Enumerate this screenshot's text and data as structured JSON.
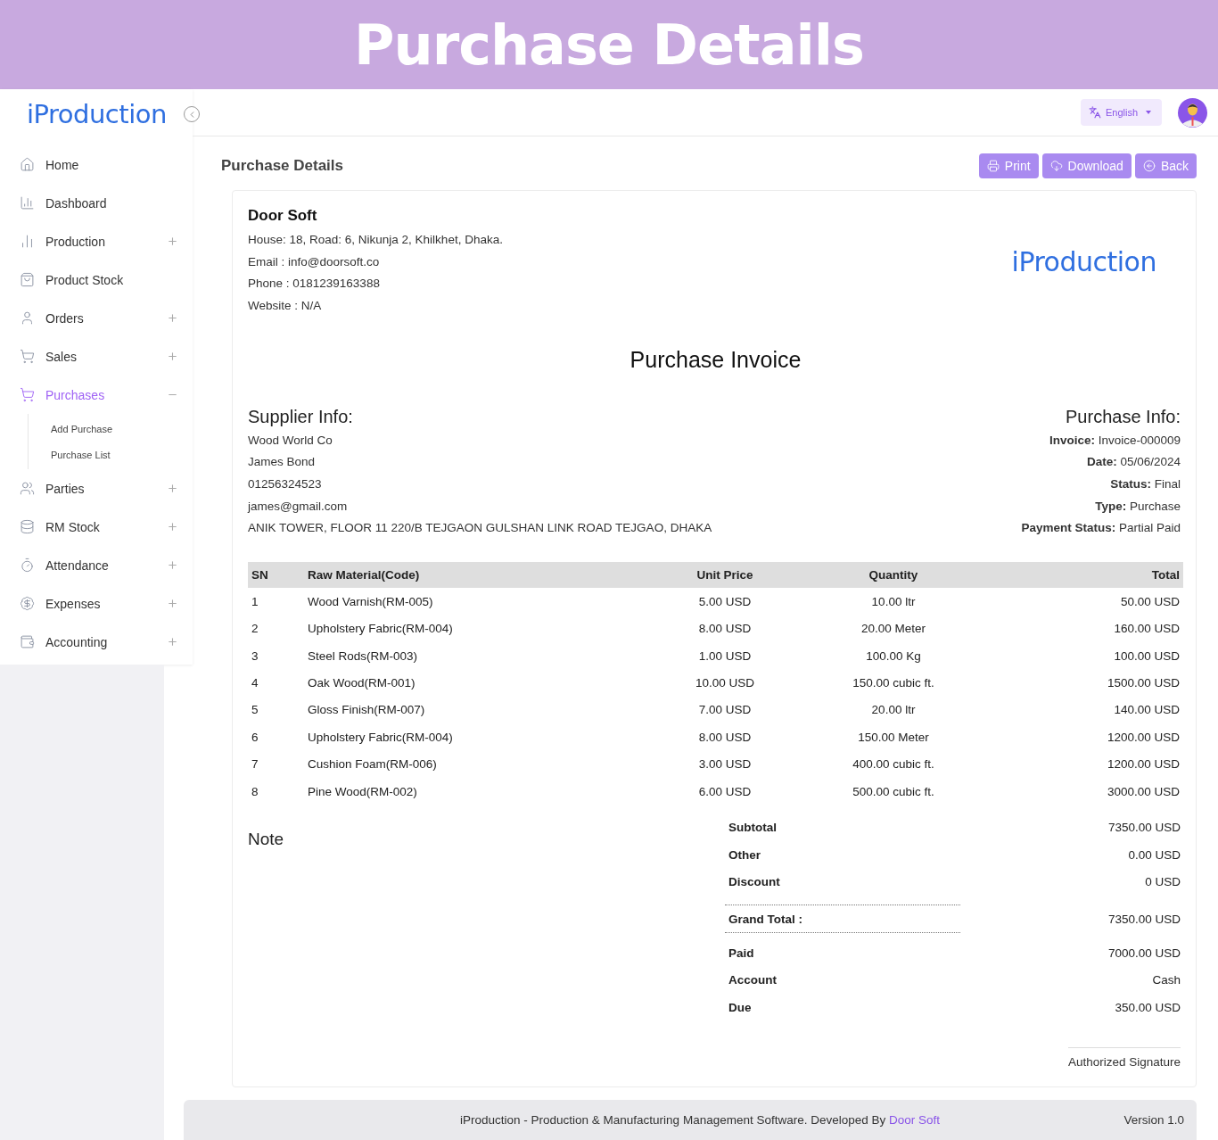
{
  "banner": {
    "title": "Purchase Details"
  },
  "sidebar": {
    "logo": "iProduction",
    "items": [
      {
        "label": "Home",
        "selected": false
      },
      {
        "label": "Dashboard",
        "selected": false
      },
      {
        "label": "Production",
        "selected": false,
        "expanded": false
      },
      {
        "label": "Product Stock",
        "selected": false
      },
      {
        "label": "Orders",
        "selected": false,
        "expanded": false
      },
      {
        "label": "Sales",
        "selected": false,
        "expanded": false
      },
      {
        "label": "Purchases",
        "selected": true,
        "expanded": true,
        "children": [
          {
            "label": "Add Purchase"
          },
          {
            "label": "Purchase List"
          }
        ]
      },
      {
        "label": "Parties",
        "selected": false,
        "expanded": false
      },
      {
        "label": "RM Stock",
        "selected": false,
        "expanded": false
      },
      {
        "label": "Attendance",
        "selected": false,
        "expanded": false
      },
      {
        "label": "Expenses",
        "selected": false,
        "expanded": false
      },
      {
        "label": "Accounting",
        "selected": false,
        "expanded": false
      }
    ]
  },
  "header": {
    "language": "English"
  },
  "page": {
    "title": "Purchase Details",
    "actions": [
      {
        "label": "Print"
      },
      {
        "label": "Download"
      },
      {
        "label": "Back"
      }
    ]
  },
  "company": {
    "name": "Door Soft",
    "lines": [
      "House: 18, Road: 6, Nikunja 2, Khilkhet, Dhaka.",
      "Email : info@doorsoft.co",
      "Phone : 0181239163388",
      "Website : N/A"
    ],
    "logo": "iProduction"
  },
  "invoice_title": "Purchase Invoice",
  "supplier": {
    "heading": "Supplier Info:",
    "lines": [
      "Wood World Co",
      "James Bond",
      "01256324523",
      "james@gmail.com",
      "ANIK TOWER, FLOOR 11 220/B TEJGAON GULSHAN LINK ROAD TEJGAO, DHAKA"
    ]
  },
  "purchase_info": {
    "heading": "Purchase Info:",
    "fields": [
      {
        "label": "Invoice:",
        "value": "Invoice-000009"
      },
      {
        "label": "Date:",
        "value": "05/06/2024"
      },
      {
        "label": "Status:",
        "value": "Final"
      },
      {
        "label": "Type:",
        "value": "Purchase"
      },
      {
        "label": "Payment Status:",
        "value": "Partial Paid"
      }
    ]
  },
  "table": {
    "columns": [
      "SN",
      "Raw Material(Code)",
      "Unit Price",
      "Quantity",
      "Total"
    ],
    "rows": [
      [
        "1",
        "Wood Varnish(RM-005)",
        "5.00 USD",
        "10.00 ltr",
        "50.00 USD"
      ],
      [
        "2",
        "Upholstery Fabric(RM-004)",
        "8.00 USD",
        "20.00 Meter",
        "160.00 USD"
      ],
      [
        "3",
        "Steel Rods(RM-003)",
        "1.00 USD",
        "100.00 Kg",
        "100.00 USD"
      ],
      [
        "4",
        "Oak Wood(RM-001)",
        "10.00 USD",
        "150.00 cubic ft.",
        "1500.00 USD"
      ],
      [
        "5",
        "Gloss Finish(RM-007)",
        "7.00 USD",
        "20.00 ltr",
        "140.00 USD"
      ],
      [
        "6",
        "Upholstery Fabric(RM-004)",
        "8.00 USD",
        "150.00 Meter",
        "1200.00 USD"
      ],
      [
        "7",
        "Cushion Foam(RM-006)",
        "3.00 USD",
        "400.00 cubic ft.",
        "1200.00 USD"
      ],
      [
        "8",
        "Pine Wood(RM-002)",
        "6.00 USD",
        "500.00 cubic ft.",
        "3000.00 USD"
      ]
    ]
  },
  "note": {
    "label": "Note"
  },
  "totals": [
    {
      "label": "Subtotal",
      "value": "7350.00 USD",
      "kind": "plain"
    },
    {
      "label": "Other",
      "value": "0.00 USD",
      "kind": "plain"
    },
    {
      "label": "Discount",
      "value": "0 USD",
      "kind": "plain"
    },
    {
      "label": "Grand Total :",
      "value": "7350.00 USD",
      "kind": "grand"
    },
    {
      "label": "Paid",
      "value": "7000.00 USD",
      "kind": "plain"
    },
    {
      "label": "Account",
      "value": "Cash",
      "kind": "plain"
    },
    {
      "label": "Due",
      "value": "350.00 USD",
      "kind": "plain"
    }
  ],
  "signature": "Authorized Signature",
  "footer": {
    "text": "iProduction - Production & Manufacturing Management Software. Developed By",
    "link": "Door Soft",
    "version": "Version 1.0"
  }
}
